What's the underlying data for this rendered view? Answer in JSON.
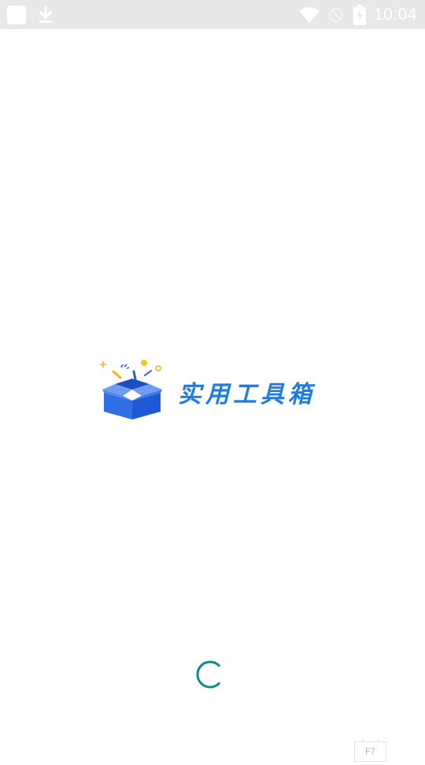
{
  "status_bar": {
    "time": "10:04",
    "background": "#e8e8e8",
    "icons": [
      "app-notification-icon",
      "download-icon",
      "wifi-icon",
      "dnd-icon",
      "battery-charging-icon"
    ]
  },
  "splash": {
    "app_name": "实用工具箱",
    "brand_color": "#1e7be3",
    "logo_icon": "open-box-icon"
  },
  "loading": {
    "indicator": "spinner-icon",
    "color": "#0f8a8a"
  },
  "key_hint": {
    "label": "F7"
  }
}
